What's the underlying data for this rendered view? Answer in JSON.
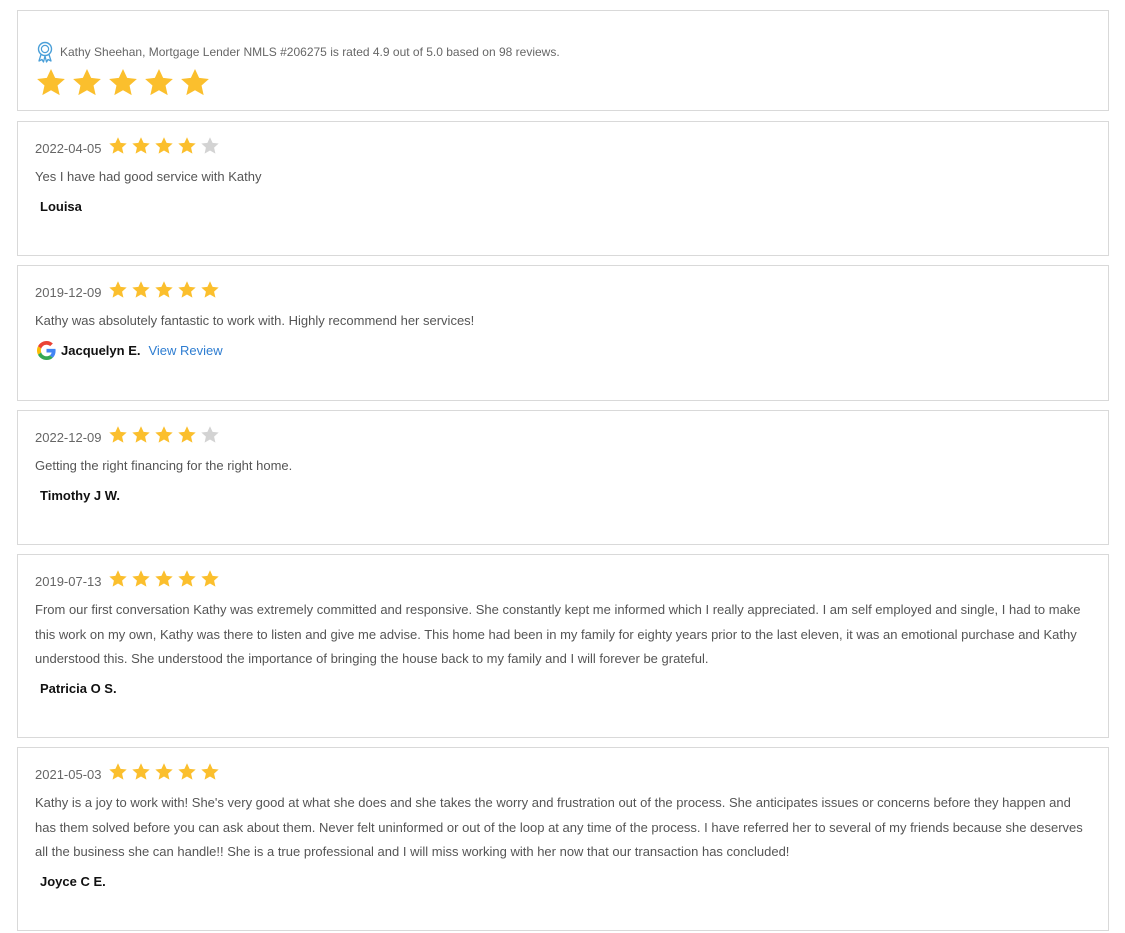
{
  "summary": {
    "text": "Kathy Sheehan, Mortgage Lender NMLS #206275 is rated 4.9 out of 5.0 based on 98 reviews.",
    "award_icon": "award-ribbon-icon",
    "stars": 5
  },
  "colors": {
    "star_filled": "#fbbf2d",
    "star_empty": "#d3d3d3",
    "link": "#2e7dd1",
    "award_icon": "#4a9fd8"
  },
  "reviews": [
    {
      "date": "2022-04-05",
      "rating": 4,
      "text": "Yes I have had good service with Kathy",
      "author": "Louisa"
    },
    {
      "date": "2019-12-09",
      "rating": 5,
      "text": "Kathy was absolutely fantastic to work with. Highly recommend her services!",
      "author": "Jacquelyn E.",
      "source_icon": "google-icon",
      "link_label": "View Review"
    },
    {
      "date": "2022-12-09",
      "rating": 4,
      "text": "Getting the right financing for the right home.",
      "author": "Timothy J W."
    },
    {
      "date": "2019-07-13",
      "rating": 5,
      "text": "From our first conversation Kathy was extremely committed and responsive. She constantly kept me informed which I really appreciated. I am self employed and single, I had to make this work on my own, Kathy was there to listen and give me advise. This home had been in my family for eighty years prior to the last eleven, it was an emotional purchase and Kathy understood this. She understood the importance of bringing the house back to my family and I will forever be grateful.",
      "author": "Patricia O S."
    },
    {
      "date": "2021-05-03",
      "rating": 5,
      "text": "Kathy is a joy to work with! She's very good at what she does and she takes the worry and frustration out of the process. She anticipates issues or concerns before they happen and has them solved before you can ask about them. Never felt uninformed or out of the loop at any time of the process. I have referred her to several of my friends because she deserves all the business she can handle!! She is a true professional and I will miss working with her now that our transaction has concluded!",
      "author": "Joyce C E."
    }
  ]
}
